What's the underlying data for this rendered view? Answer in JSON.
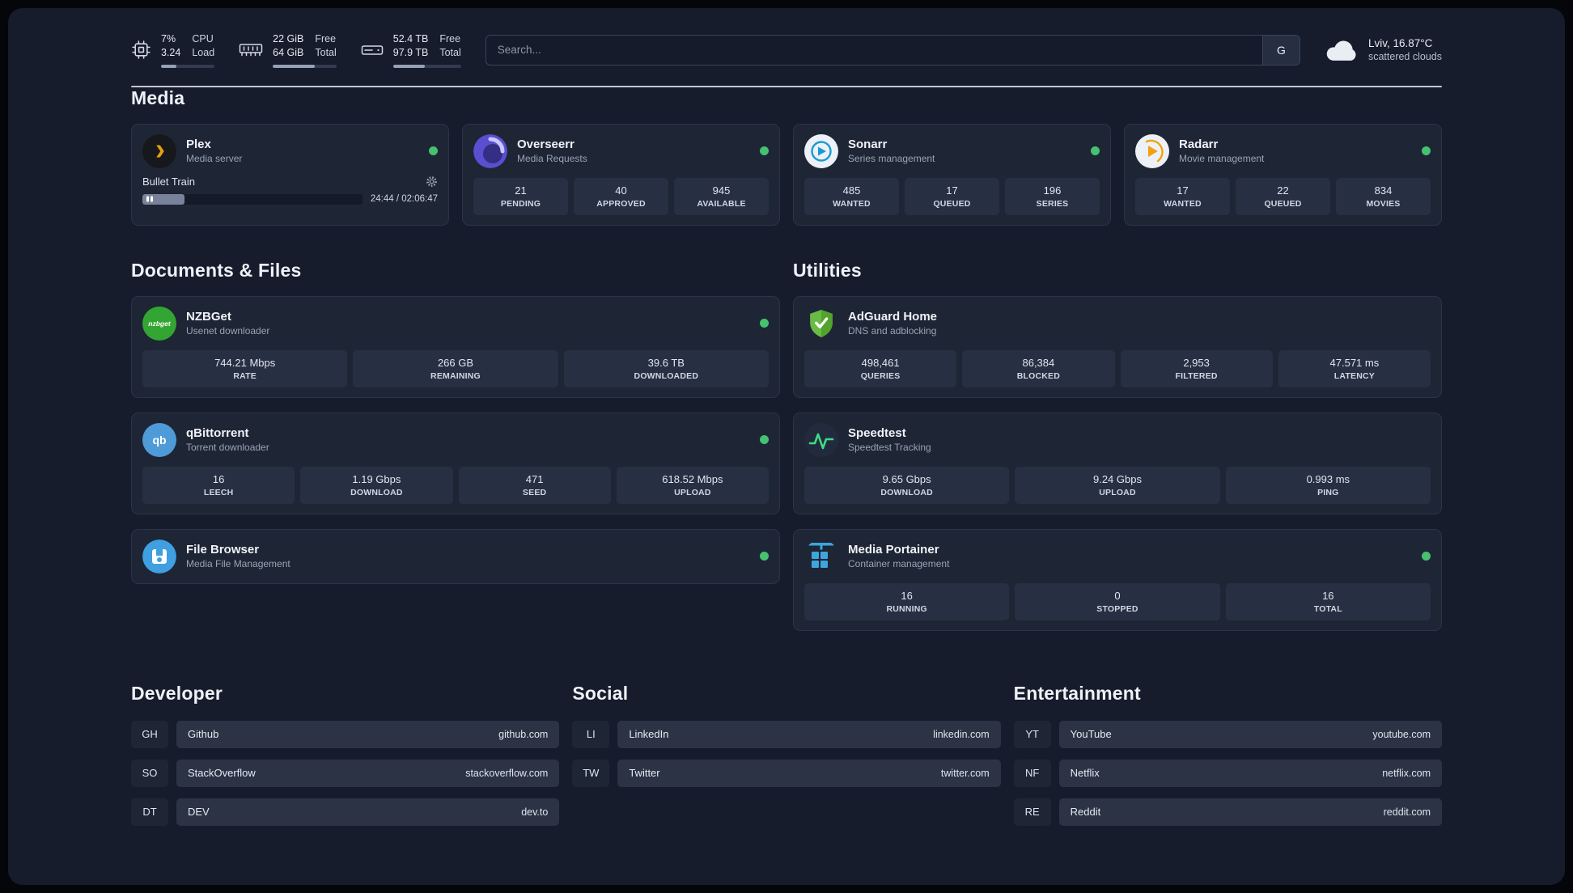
{
  "topbar": {
    "cpu": {
      "value_top": "7%",
      "value_bottom": "3.24",
      "label_top": "CPU",
      "label_bottom": "Load",
      "progress": "28%"
    },
    "ram": {
      "value_top": "22 GiB",
      "value_bottom": "64 GiB",
      "label_top": "Free",
      "label_bottom": "Total",
      "progress": "66%"
    },
    "disk": {
      "value_top": "52.4 TB",
      "value_bottom": "97.9 TB",
      "label_top": "Free",
      "label_bottom": "Total",
      "progress": "47%"
    },
    "search": {
      "placeholder": "Search...",
      "button_label": "G"
    },
    "weather": {
      "location": "Lviv, 16.87°C",
      "condition": "scattered clouds"
    }
  },
  "sections": {
    "media": {
      "heading": "Media",
      "plex": {
        "title": "Plex",
        "subtitle": "Media server",
        "now_playing": "Bullet Train",
        "progress": "19%",
        "time": "24:44 / 02:06:47"
      },
      "overseerr": {
        "title": "Overseerr",
        "subtitle": "Media Requests",
        "stats": [
          {
            "value": "21",
            "label": "PENDING"
          },
          {
            "value": "40",
            "label": "APPROVED"
          },
          {
            "value": "945",
            "label": "AVAILABLE"
          }
        ]
      },
      "sonarr": {
        "title": "Sonarr",
        "subtitle": "Series management",
        "stats": [
          {
            "value": "485",
            "label": "WANTED"
          },
          {
            "value": "17",
            "label": "QUEUED"
          },
          {
            "value": "196",
            "label": "SERIES"
          }
        ]
      },
      "radarr": {
        "title": "Radarr",
        "subtitle": "Movie management",
        "stats": [
          {
            "value": "17",
            "label": "WANTED"
          },
          {
            "value": "22",
            "label": "QUEUED"
          },
          {
            "value": "834",
            "label": "MOVIES"
          }
        ]
      }
    },
    "documents": {
      "heading": "Documents & Files",
      "nzbget": {
        "title": "NZBGet",
        "subtitle": "Usenet downloader",
        "icon_text": "nzbget",
        "stats": [
          {
            "value": "744.21 Mbps",
            "label": "RATE"
          },
          {
            "value": "266 GB",
            "label": "REMAINING"
          },
          {
            "value": "39.6 TB",
            "label": "DOWNLOADED"
          }
        ]
      },
      "qbittorrent": {
        "title": "qBittorrent",
        "subtitle": "Torrent downloader",
        "icon_text": "qb",
        "stats": [
          {
            "value": "16",
            "label": "LEECH"
          },
          {
            "value": "1.19 Gbps",
            "label": "DOWNLOAD"
          },
          {
            "value": "471",
            "label": "SEED"
          },
          {
            "value": "618.52 Mbps",
            "label": "UPLOAD"
          }
        ]
      },
      "filebrowser": {
        "title": "File Browser",
        "subtitle": "Media File Management"
      }
    },
    "utilities": {
      "heading": "Utilities",
      "adguard": {
        "title": "AdGuard Home",
        "subtitle": "DNS and adblocking",
        "stats": [
          {
            "value": "498,461",
            "label": "QUERIES"
          },
          {
            "value": "86,384",
            "label": "BLOCKED"
          },
          {
            "value": "2,953",
            "label": "FILTERED"
          },
          {
            "value": "47.571 ms",
            "label": "LATENCY"
          }
        ]
      },
      "speedtest": {
        "title": "Speedtest",
        "subtitle": "Speedtest Tracking",
        "stats": [
          {
            "value": "9.65 Gbps",
            "label": "DOWNLOAD"
          },
          {
            "value": "9.24 Gbps",
            "label": "UPLOAD"
          },
          {
            "value": "0.993 ms",
            "label": "PING"
          }
        ]
      },
      "portainer": {
        "title": "Media Portainer",
        "subtitle": "Container management",
        "stats": [
          {
            "value": "16",
            "label": "RUNNING"
          },
          {
            "value": "0",
            "label": "STOPPED"
          },
          {
            "value": "16",
            "label": "TOTAL"
          }
        ]
      }
    },
    "bookmarks": [
      {
        "heading": "Developer",
        "items": [
          {
            "abbr": "GH",
            "name": "Github",
            "url": "github.com"
          },
          {
            "abbr": "SO",
            "name": "StackOverflow",
            "url": "stackoverflow.com"
          },
          {
            "abbr": "DT",
            "name": "DEV",
            "url": "dev.to"
          }
        ]
      },
      {
        "heading": "Social",
        "items": [
          {
            "abbr": "LI",
            "name": "LinkedIn",
            "url": "linkedin.com"
          },
          {
            "abbr": "TW",
            "name": "Twitter",
            "url": "twitter.com"
          }
        ]
      },
      {
        "heading": "Entertainment",
        "items": [
          {
            "abbr": "YT",
            "name": "YouTube",
            "url": "youtube.com"
          },
          {
            "abbr": "NF",
            "name": "Netflix",
            "url": "netflix.com"
          },
          {
            "abbr": "RE",
            "name": "Reddit",
            "url": "reddit.com"
          }
        ]
      }
    ]
  },
  "colors": {
    "status_green": "#45c16f",
    "plex_orange": "#e5a00d",
    "adguard_green": "#68bc46",
    "portainer_blue": "#3ca6dd",
    "speedtest_green": "#3ddc84",
    "sonarr_blue": "#1b9ad1",
    "radarr_gold": "#f2a20c"
  }
}
